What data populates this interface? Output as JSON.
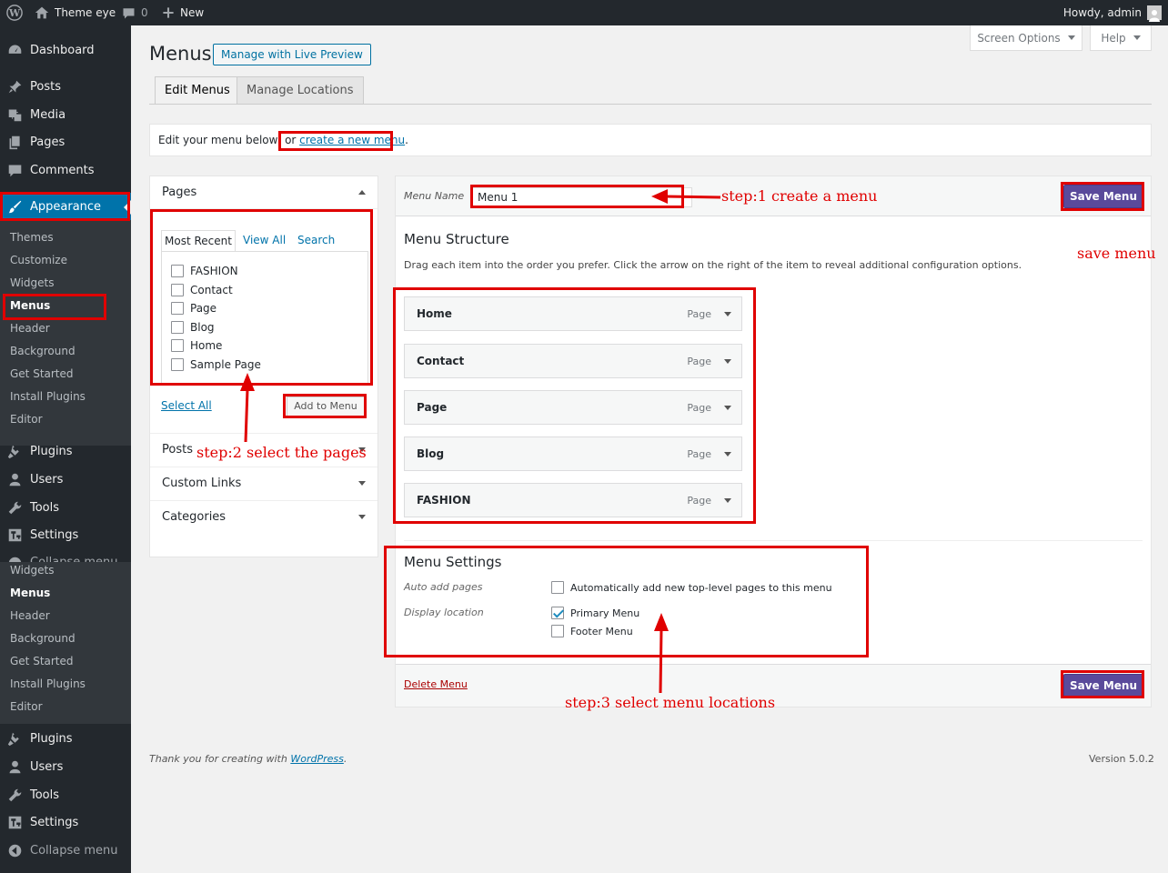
{
  "admin_bar": {
    "site_name": "Theme eye",
    "comments_count": "0",
    "new_label": "New",
    "howdy": "Howdy, admin"
  },
  "sidebar": {
    "dashboard": "Dashboard",
    "posts": "Posts",
    "media": "Media",
    "pages": "Pages",
    "comments": "Comments",
    "appearance": "Appearance",
    "appearance_sub": [
      "Themes",
      "Customize",
      "Widgets",
      "Menus",
      "Header",
      "Background",
      "Get Started",
      "Install Plugins",
      "Editor"
    ],
    "plugins": "Plugins",
    "users": "Users",
    "tools": "Tools",
    "settings": "Settings",
    "collapse": "Collapse menu",
    "dup_sub": [
      "Widgets",
      "Menus",
      "Header",
      "Background",
      "Get Started",
      "Install Plugins",
      "Editor"
    ],
    "dup_plugins": "Plugins",
    "dup_users": "Users",
    "dup_tools": "Tools",
    "dup_settings": "Settings",
    "dup_collapse": "Collapse menu"
  },
  "header": {
    "title": "Menus",
    "live_preview": "Manage with Live Preview",
    "screen_options": "Screen Options",
    "help": "Help"
  },
  "tabs": {
    "edit": "Edit Menus",
    "manage": "Manage Locations"
  },
  "notice": {
    "text": "Edit your menu below, or ",
    "link": "create a new menu",
    "end": "."
  },
  "pages_box": {
    "title": "Pages",
    "tabs": [
      "Most Recent",
      "View All",
      "Search"
    ],
    "items": [
      "FASHION",
      "Contact",
      "Page",
      "Blog",
      "Home",
      "Sample Page"
    ],
    "select_all": "Select All",
    "add_to_menu": "Add to Menu"
  },
  "accordions": [
    "Posts",
    "Custom Links",
    "Categories"
  ],
  "menu_editor": {
    "menu_name_label": "Menu Name",
    "menu_name_value": "Menu 1",
    "save_label": "Save Menu",
    "structure_title": "Menu Structure",
    "structure_desc": "Drag each item into the order you prefer. Click the arrow on the right of the item to reveal additional configuration options.",
    "items": [
      {
        "title": "Home",
        "type": "Page"
      },
      {
        "title": "Contact",
        "type": "Page"
      },
      {
        "title": "Page",
        "type": "Page"
      },
      {
        "title": "Blog",
        "type": "Page"
      },
      {
        "title": "FASHION",
        "type": "Page"
      }
    ],
    "settings_title": "Menu Settings",
    "auto_add_label": "Auto add pages",
    "auto_add_text": "Automatically add new top-level pages to this menu",
    "display_location_label": "Display location",
    "locations": [
      {
        "label": "Primary Menu",
        "checked": true
      },
      {
        "label": "Footer Menu",
        "checked": false
      }
    ],
    "delete_label": "Delete Menu"
  },
  "annotations": {
    "step1": "step:1 create a menu",
    "step2": "step:2 select the pages",
    "step3": "step:3 select menu locations",
    "save": "save menu"
  },
  "footer": {
    "thanks": "Thank you for creating with ",
    "wp_link": "WordPress",
    "period": ".",
    "version": "Version 5.0.2"
  },
  "colors": {
    "accent": "#0073aa",
    "save_button": "#5a4a9b",
    "annotation": "#e00000"
  }
}
